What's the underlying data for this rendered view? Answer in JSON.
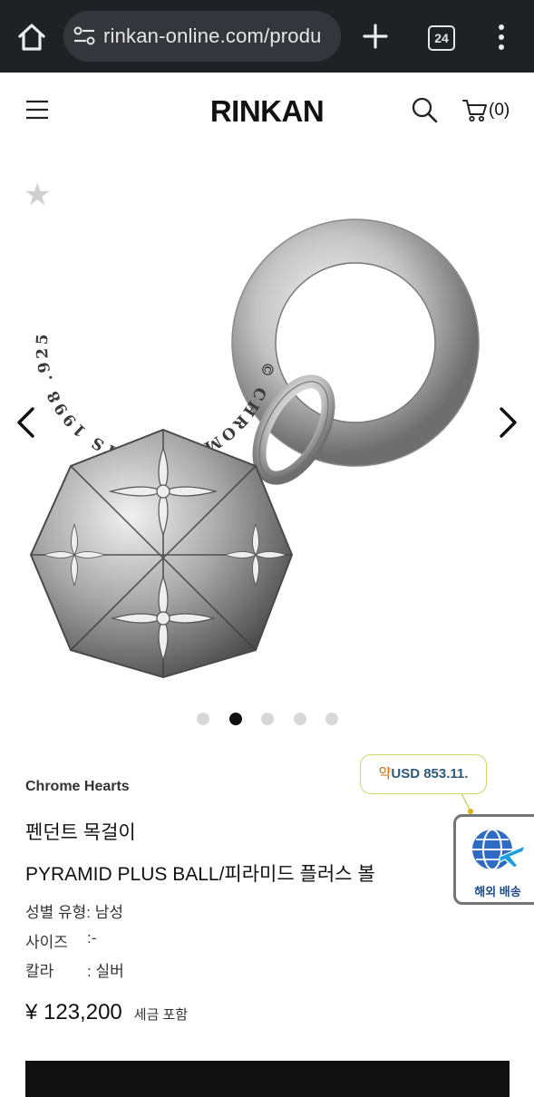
{
  "browser": {
    "url": "rinkan-online.com/produ",
    "tab_count": "24"
  },
  "header": {
    "logo": "RINKAN",
    "cart_count": "(0)"
  },
  "gallery": {
    "slide_count": 5,
    "active_slide": 2,
    "pendant_ring_text": "CHROME HEARTS",
    "pendant_engraving": "© CHROME HEARTS 1998 .925"
  },
  "product": {
    "brand": "Chrome Hearts",
    "category": "펜던트 목걸이",
    "name": "PYRAMID PLUS BALL/피라미드 플러스 볼",
    "specs": [
      {
        "label": "성별 유형",
        "value": ": 남성"
      },
      {
        "label": "사이즈",
        "value": ":-"
      },
      {
        "label": "칼라",
        "value": ": 실버"
      }
    ],
    "price": "¥ 123,200",
    "tax_note": "세금 포함"
  },
  "usd_badge": {
    "prefix": "약",
    "amount": "USD 853.11."
  },
  "overseas_shipping": {
    "label": "해외 배송"
  },
  "colors": {
    "chrome_bar": "#1f2124",
    "url_pill": "#33363b",
    "bubble_border": "#c6d96a",
    "ship_blue": "#1f4c8a"
  },
  "icons": [
    "home-icon",
    "site-settings-icon",
    "plus-icon",
    "tab-switcher-icon",
    "more-vert-icon",
    "hamburger-icon",
    "search-icon",
    "cart-icon",
    "star-icon",
    "chevron-left-icon",
    "chevron-right-icon",
    "globe-plane-icon"
  ]
}
